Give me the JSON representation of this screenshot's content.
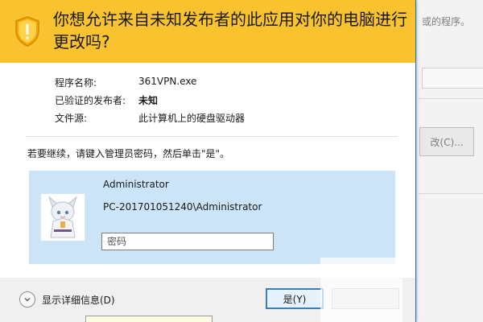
{
  "dialog": {
    "title": "你想允许来自未知发布者的此应用对你的电脑进行更改吗?",
    "info": {
      "program_label": "程序名称:",
      "program_value": "361VPN.exe",
      "publisher_label": "已验证的发布者:",
      "publisher_value": "未知",
      "source_label": "文件源:",
      "source_value": "此计算机上的硬盘驱动器"
    },
    "instruction": "若要继续，请键入管理员密码，然后单击\"是\"。",
    "credential": {
      "username": "Administrator",
      "account": "PC-201701051240\\Administrator",
      "password_placeholder": "密码"
    },
    "footer": {
      "details_label": "显示详细信息(D)",
      "yes_label": "是(Y)"
    }
  },
  "background": {
    "text_top": "或的程序。",
    "button_label": "改(C)..."
  },
  "colors": {
    "banner": "#f9c32f",
    "credential_panel": "#cce4f7",
    "accent_border": "#3c7fb1"
  },
  "icons": {
    "shield": "uac-shield-icon",
    "expand": "chevron-down-icon",
    "avatar": "user-avatar"
  }
}
